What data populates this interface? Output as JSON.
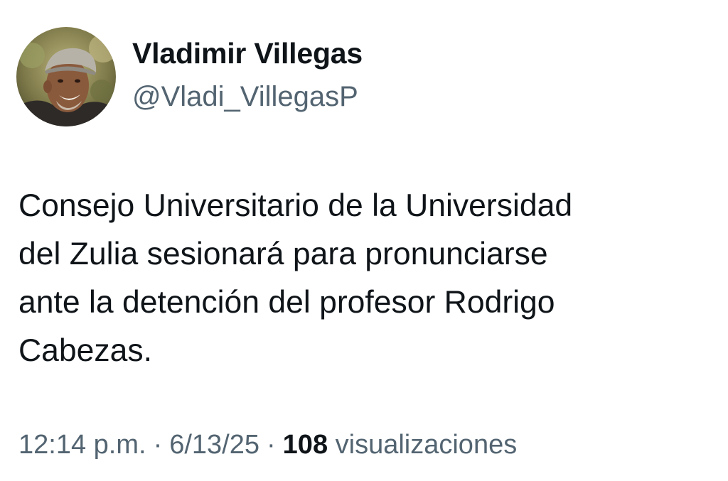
{
  "author": {
    "display_name": "Vladimir Villegas",
    "handle": "@Vladi_VillegasP"
  },
  "tweet": {
    "text": "Consejo Universitario de la Universidad\ndel Zulia sesionará para pronunciarse\nante la detención del profesor Rodrigo\nCabezas."
  },
  "meta": {
    "time": "12:14 p.m.",
    "separator": "·",
    "date": "6/13/25",
    "views_count": "108",
    "views_label": "visualizaciones"
  },
  "colors": {
    "primary_text": "#0f1419",
    "secondary_text": "#536471",
    "background": "#ffffff"
  }
}
